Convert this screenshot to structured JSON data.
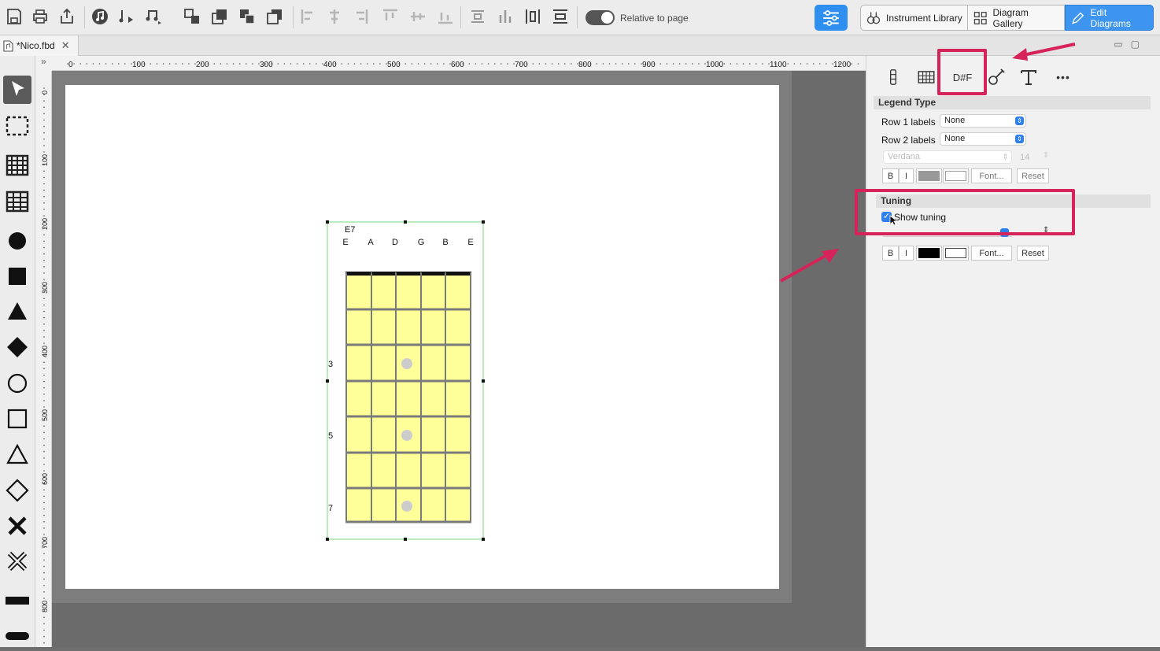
{
  "toolbar": {
    "relative_to_page": "Relative to page",
    "instrument_library": "Instrument Library",
    "diagram_gallery": "Diagram Gallery",
    "edit_diagrams": "Edit Diagrams"
  },
  "document": {
    "tab_label": "*Nico.fbd"
  },
  "ruler": {
    "horizontal": [
      "0",
      "100",
      "200",
      "300",
      "400",
      "500",
      "600",
      "700",
      "800",
      "900",
      "1000",
      "1100",
      "1200"
    ],
    "vertical": [
      "0",
      "100",
      "200",
      "300",
      "400",
      "500",
      "600",
      "700",
      "800"
    ],
    "corner": "»"
  },
  "diagram": {
    "chord_name": "E7",
    "strings": [
      "E",
      "A",
      "D",
      "G",
      "B",
      "E"
    ],
    "fret_labels": [
      "3",
      "5",
      "7"
    ]
  },
  "panel": {
    "tab_label": "D#F",
    "more": "•••",
    "legend": {
      "header": "Legend Type",
      "row1_label": "Row 1 labels",
      "row1_value": "None",
      "row2_label": "Row 2 labels",
      "row2_value": "None",
      "font_name": "Verdana",
      "font_size": "14",
      "bold": "B",
      "italic": "I",
      "font_btn": "Font...",
      "reset_btn": "Reset"
    },
    "tuning": {
      "header": "Tuning",
      "show_tuning": "Show tuning",
      "bold": "B",
      "italic": "I",
      "font_btn": "Font...",
      "reset_btn": "Reset"
    }
  },
  "colors": {
    "accent": "#3d95f0",
    "highlight": "#d6245a",
    "fretboard": "#ffff99",
    "selection": "#7ed67e"
  }
}
